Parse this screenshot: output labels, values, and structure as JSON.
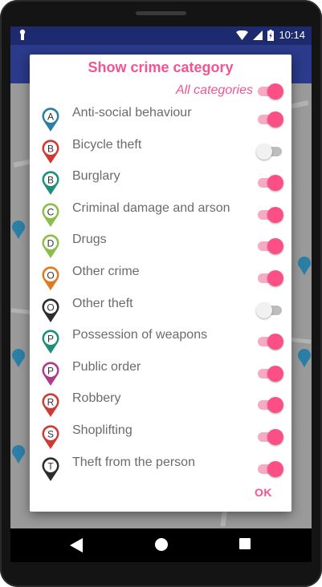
{
  "status_bar": {
    "time": "10:14",
    "icons": [
      "lock-icon",
      "wifi-icon",
      "signal-icon",
      "battery-icon"
    ]
  },
  "dialog": {
    "title": "Show crime category",
    "all_categories": {
      "label": "All categories",
      "enabled": true
    },
    "ok_label": "OK",
    "categories": [
      {
        "letter": "A",
        "label": "Anti-social behaviour",
        "color": "#2a7fa6",
        "enabled": true
      },
      {
        "letter": "B",
        "label": "Bicycle theft",
        "color": "#d03a36",
        "enabled": false
      },
      {
        "letter": "B",
        "label": "Burglary",
        "color": "#1f8f7a",
        "enabled": true
      },
      {
        "letter": "C",
        "label": "Criminal damage and arson",
        "color": "#8bbf4a",
        "enabled": true
      },
      {
        "letter": "D",
        "label": "Drugs",
        "color": "#8bbf4a",
        "enabled": true
      },
      {
        "letter": "O",
        "label": "Other crime",
        "color": "#e07a1f",
        "enabled": true
      },
      {
        "letter": "O",
        "label": "Other theft",
        "color": "#2d2d2d",
        "enabled": false
      },
      {
        "letter": "P",
        "label": "Possession of weapons",
        "color": "#1f8f7a",
        "enabled": true
      },
      {
        "letter": "P",
        "label": "Public order",
        "color": "#b03a8a",
        "enabled": true
      },
      {
        "letter": "R",
        "label": "Robbery",
        "color": "#d03a36",
        "enabled": true
      },
      {
        "letter": "S",
        "label": "Shoplifting",
        "color": "#d03a36",
        "enabled": true
      },
      {
        "letter": "T",
        "label": "Theft from the person",
        "color": "#2d2d2d",
        "enabled": true
      }
    ]
  },
  "colors": {
    "accent": "#f25492",
    "toggle_on": "#fc4f86",
    "toggle_on_track": "#f8a9c6",
    "toggle_off_track": "#bdbdbd",
    "app_bar": "#2b3a8a"
  },
  "nav_bar": {
    "icons": [
      "back-icon",
      "home-icon",
      "recent-apps-icon"
    ]
  }
}
